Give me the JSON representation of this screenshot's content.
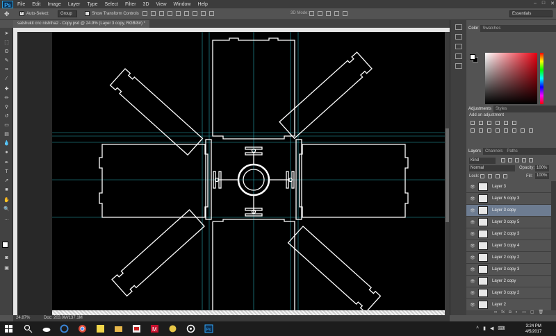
{
  "app": {
    "logo": "Ps",
    "menus": [
      "File",
      "Edit",
      "Image",
      "Layer",
      "Type",
      "Select",
      "Filter",
      "3D",
      "View",
      "Window",
      "Help"
    ],
    "window_controls": [
      "–",
      "□",
      "✕"
    ]
  },
  "options": {
    "auto_select_label": "Auto-Select:",
    "group_value": "Group",
    "transform_label": "Show Transform Controls",
    "mode_3d_label": "3D Mode:",
    "workspace": "Essentials"
  },
  "document": {
    "tab_title": "satshukit cnc nishtha2 - Copy.psd @ 24.9% (Layer 3 copy, RGB/8#) *",
    "zoom": "24.87%",
    "doc_size": "Doc: 203.0M/137.1M"
  },
  "panels": {
    "color_tabs": [
      "Color",
      "Swatches"
    ],
    "adjust_tabs": [
      "Adjustments",
      "Styles"
    ],
    "adjust_label": "Add an adjustment",
    "layers_tabs": [
      "Layers",
      "Channels",
      "Paths"
    ],
    "kind_label": "Kind",
    "blend_mode": "Normal",
    "opacity_label": "Opacity:",
    "opacity_value": "100%",
    "lock_label": "Lock:",
    "fill_label": "Fill:",
    "fill_value": "100%"
  },
  "layers": [
    {
      "name": "Layer 3",
      "selected": false
    },
    {
      "name": "Layer 5 copy 3",
      "selected": false
    },
    {
      "name": "Layer 3 copy",
      "selected": true
    },
    {
      "name": "Layer 3 copy 5",
      "selected": false
    },
    {
      "name": "Layer 2 copy 3",
      "selected": false
    },
    {
      "name": "Layer 3 copy 4",
      "selected": false
    },
    {
      "name": "Layer 2 copy 2",
      "selected": false
    },
    {
      "name": "Layer 3 copy 3",
      "selected": false
    },
    {
      "name": "Layer 2 copy",
      "selected": false
    },
    {
      "name": "Layer 3 copy 2",
      "selected": false
    },
    {
      "name": "Layer 2",
      "selected": false
    }
  ],
  "taskbar": {
    "time": "3:24 PM",
    "date": "4/5/2017"
  },
  "colors": {
    "accent_selected": "#6d7c91",
    "guide": "#2aa7b2",
    "shape_stroke": "#ffffff"
  }
}
